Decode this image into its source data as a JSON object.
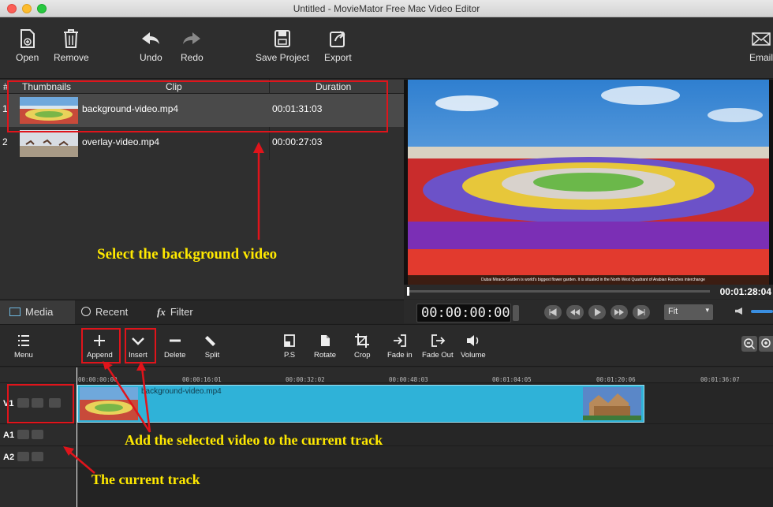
{
  "window": {
    "title": "Untitled - MovieMator Free Mac Video Editor"
  },
  "toolbar": {
    "open": "Open",
    "remove": "Remove",
    "undo": "Undo",
    "redo": "Redo",
    "save_project": "Save Project",
    "export": "Export",
    "email": "Email"
  },
  "media_list": {
    "columns": {
      "num": "#",
      "thumbnails": "Thumbnails",
      "clip": "Clip",
      "duration": "Duration"
    },
    "rows": [
      {
        "num": "1",
        "clip": "background-video.mp4",
        "duration": "00:01:31:03"
      },
      {
        "num": "2",
        "clip": "overlay-video.mp4",
        "duration": "00:00:27:03"
      }
    ],
    "tabs": {
      "media": "Media",
      "recent": "Recent",
      "filter": "Filter"
    }
  },
  "preview": {
    "caption": "Dubai Miracle Garden is world's biggest flower garden. It is situated in the North West Quadrant of Arabian Ranches interchange",
    "duration": "00:01:28:04",
    "timecode": "00:00:00:00",
    "zoom": "Fit"
  },
  "edit_toolbar": {
    "menu": "Menu",
    "append": "Append",
    "insert": "Insert",
    "delete": "Delete",
    "split": "Split",
    "ps": "P.S",
    "rotate": "Rotate",
    "crop": "Crop",
    "fade_in": "Fade in",
    "fade_out": "Fade Out",
    "volume": "Volume"
  },
  "timeline": {
    "ruler": [
      "00:00:00:00",
      "00:00:16:01",
      "00:00:32:02",
      "00:00:48:03",
      "00:01:04:05",
      "00:01:20:06",
      "00:01:36:07"
    ],
    "tracks": {
      "v1": "V1",
      "a1": "A1",
      "a2": "A2"
    },
    "clip_name": "background-video.mp4"
  },
  "annotations": {
    "select_bg": "Select the background video",
    "add_selected": "Add the selected video to the current track",
    "current_track": "The current track"
  },
  "colors": {
    "annotation_text": "#ffe900",
    "annotation_red": "#e0141b",
    "clip_blue": "#2fb2d8"
  }
}
